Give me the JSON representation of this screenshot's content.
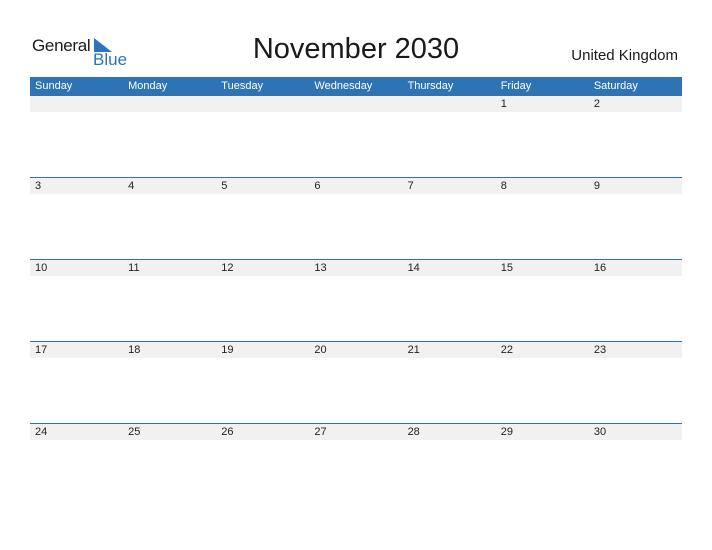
{
  "logo": {
    "general": "General",
    "blue": "Blue"
  },
  "title": "November 2030",
  "country": "United Kingdom",
  "colors": {
    "accent": "#2e74b5",
    "strip": "#f1f1f1"
  },
  "weekdays": [
    "Sunday",
    "Monday",
    "Tuesday",
    "Wednesday",
    "Thursday",
    "Friday",
    "Saturday"
  ],
  "weeks": [
    [
      "",
      "",
      "",
      "",
      "",
      "1",
      "2"
    ],
    [
      "3",
      "4",
      "5",
      "6",
      "7",
      "8",
      "9"
    ],
    [
      "10",
      "11",
      "12",
      "13",
      "14",
      "15",
      "16"
    ],
    [
      "17",
      "18",
      "19",
      "20",
      "21",
      "22",
      "23"
    ],
    [
      "24",
      "25",
      "26",
      "27",
      "28",
      "29",
      "30"
    ]
  ]
}
